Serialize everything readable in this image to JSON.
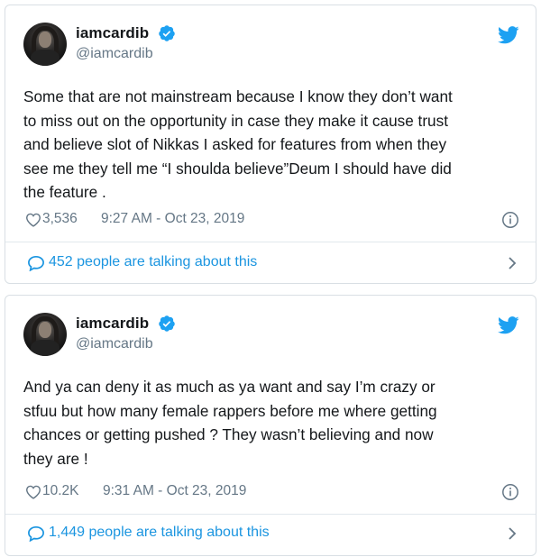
{
  "tweets": [
    {
      "display_name": "iamcardib",
      "handle": "@iamcardib",
      "text": "Some that are not mainstream because I know they don’t want\nto miss out on the opportunity in case they make it cause trust\nand believe slot of Nikkas I asked for features from when they\nsee me they tell me “I shoulda believe”Deum I should have did\nthe feature .",
      "likes": "3,536",
      "timestamp": "9:27 AM - Oct 23, 2019",
      "talking": "452 people are talking about this"
    },
    {
      "display_name": "iamcardib",
      "handle": "@iamcardib",
      "text": "And ya can deny it as much as ya want and say I’m crazy or\nstfuu but how many female rappers before me where getting\nchances or getting pushed ? They wasn’t believing and now\nthey are !",
      "likes": "10.2K",
      "timestamp": "9:31 AM - Oct 23, 2019",
      "talking": "1,449 people are talking about this"
    }
  ],
  "icons": {
    "verified": "verified-badge-icon",
    "bird": "twitter-bird-icon",
    "like": "heart-icon",
    "info": "info-icon",
    "reply": "speech-bubble-icon",
    "chevron": "chevron-right-icon"
  },
  "colors": {
    "accent": "#1da1f2",
    "link": "#1b95e0",
    "muted": "#657786",
    "text": "#14171a",
    "border": "#d9dfe4"
  }
}
